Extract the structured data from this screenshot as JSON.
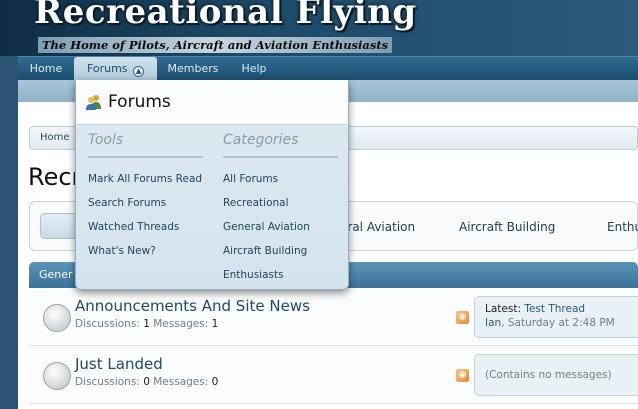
{
  "header": {
    "site_title": "Recreational Flying",
    "tagline": "The Home of Pilots, Aircraft and Aviation Enthusiasts"
  },
  "nav": {
    "tabs": [
      {
        "label": "Home"
      },
      {
        "label": "Forums"
      },
      {
        "label": "Members"
      },
      {
        "label": "Help"
      }
    ]
  },
  "breadcrumb": {
    "home": "Home"
  },
  "page": {
    "title": "Recreational Flying",
    "visible_title": "Recr"
  },
  "category_tabs": [
    {
      "label": "eral Aviation"
    },
    {
      "label": "Aircraft Building"
    },
    {
      "label": "Enthu"
    }
  ],
  "category_strip": {
    "label": "Gener"
  },
  "forums": [
    {
      "title": "Announcements And Site News",
      "discussions_label": "Discussions:",
      "discussions": "1",
      "messages_label": "Messages:",
      "messages": "1",
      "latest_label": "Latest:",
      "latest_thread": "Test Thread",
      "latest_user": "Ian",
      "latest_time": "Saturday at 2:48 PM"
    },
    {
      "title": "Just Landed",
      "discussions_label": "Discussions:",
      "discussions": "0",
      "messages_label": "Messages:",
      "messages": "0",
      "empty_text": "(Contains no messages)"
    }
  ],
  "dropdown": {
    "title": "Forums",
    "tools": {
      "heading": "Tools",
      "links": [
        "Mark All Forums Read",
        "Search Forums",
        "Watched Threads",
        "What's New?"
      ]
    },
    "categories": {
      "heading": "Categories",
      "links": [
        "All Forums",
        "Recreational",
        "General Aviation",
        "Aircraft Building",
        "Enthusiasts"
      ]
    }
  },
  "icons": {
    "forums_icon": "users-icon",
    "nav_dropdown": "chevron-up-icon",
    "forum_status": "forum-read-icon",
    "rss": "rss-icon"
  },
  "colors": {
    "header_dark": "#0f2d45",
    "nav_bar": "#1d4e70",
    "active_tab": "#aecadb",
    "dropdown_bg": "#d4e4ee",
    "link": "#22455f"
  }
}
